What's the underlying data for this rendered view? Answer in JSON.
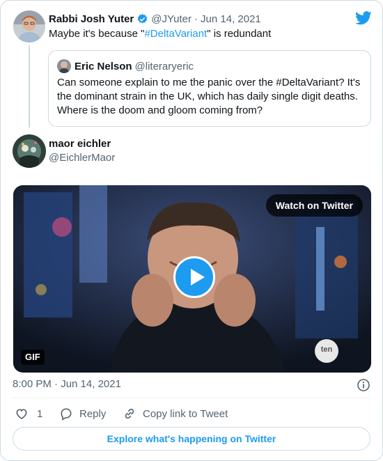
{
  "tweet": {
    "author_name": "Rabbi Josh Yuter",
    "handle": "@JYuter",
    "separator": "·",
    "date": "Jun 14, 2021",
    "text_before": "Maybe it's because \"",
    "hashtag": "#DeltaVariant",
    "text_after": "\" is redundant"
  },
  "quoted_tweet": {
    "author_name": "Eric Nelson",
    "handle": "@literaryeric",
    "text": "Can someone explain to me the panic over the #DeltaVariant? It's the dominant strain in the UK, which has daily single digit deaths. Where is the doom and gloom coming from?"
  },
  "reply": {
    "author_name": "maor eichler",
    "handle": "@EichlerMaor"
  },
  "media": {
    "watch_label": "Watch on Twitter",
    "gif_badge": "GIF",
    "watermark": "ten"
  },
  "footer": {
    "timestamp": "8:00 PM · Jun 14, 2021",
    "like_count": "1",
    "reply_label": "Reply",
    "copy_link_label": "Copy link to Tweet",
    "explore_label": "Explore what's happening on Twitter"
  },
  "colors": {
    "accent": "#1d9bf0",
    "muted": "#536471",
    "border": "#cfd9de"
  },
  "icons": [
    "twitter-bird-icon",
    "verified-badge-icon",
    "play-icon",
    "info-icon",
    "heart-icon",
    "reply-icon",
    "link-icon"
  ]
}
